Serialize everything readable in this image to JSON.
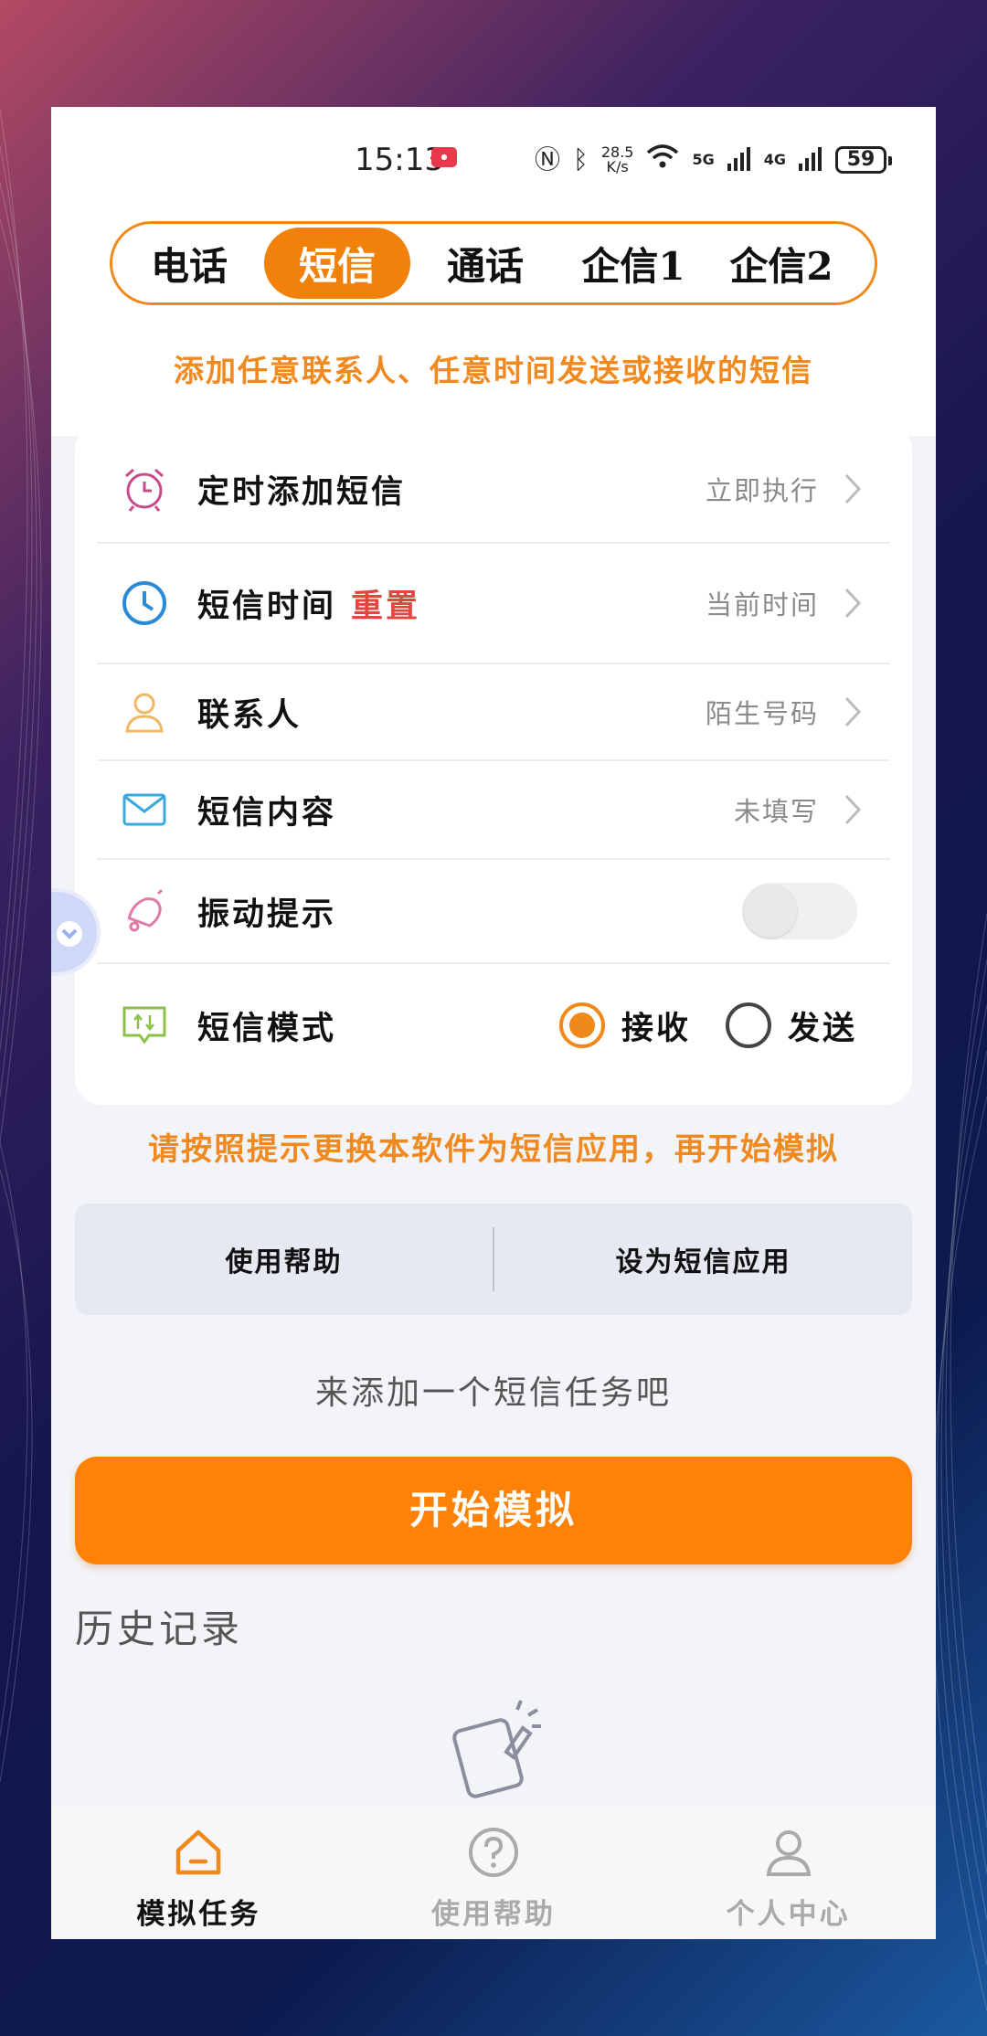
{
  "status_bar": {
    "time": "15:13",
    "net_speed": "28.5",
    "net_speed_unit": "K/s",
    "sim1": "5G",
    "sim2": "4G",
    "battery": "59"
  },
  "tabs": [
    {
      "label": "电话",
      "active": false
    },
    {
      "label": "短信",
      "active": true
    },
    {
      "label": "通话",
      "active": false
    },
    {
      "label": "企信1",
      "active": false
    },
    {
      "label": "企信2",
      "active": false
    }
  ],
  "notice": "添加任意联系人、任意时间发送或接收的短信",
  "settings": {
    "scheduled": {
      "label": "定时添加短信",
      "value": "立即执行"
    },
    "sms_time": {
      "label": "短信时间",
      "reset": "重置",
      "value": "当前时间"
    },
    "contact": {
      "label": "联系人",
      "value": "陌生号码"
    },
    "content": {
      "label": "短信内容",
      "value": "未填写"
    },
    "vibrate": {
      "label": "振动提示",
      "enabled": false
    },
    "mode": {
      "label": "短信模式",
      "options": [
        "接收",
        "发送"
      ],
      "selected": "接收"
    }
  },
  "hint": "请按照提示更换本软件为短信应用，再开始模拟",
  "buttons": {
    "help": "使用帮助",
    "set_default": "设为短信应用"
  },
  "empty_tip": "来添加一个短信任务吧",
  "start_button": "开始模拟",
  "history_title": "历史记录",
  "bottom_nav": [
    {
      "label": "模拟任务",
      "icon": "home-icon",
      "active": true
    },
    {
      "label": "使用帮助",
      "icon": "help-circle-icon",
      "active": false
    },
    {
      "label": "个人中心",
      "icon": "person-icon",
      "active": false
    }
  ],
  "colors": {
    "accent": "#f0820c",
    "reset_red": "#e2463f",
    "hint_orange": "#f08a20"
  }
}
